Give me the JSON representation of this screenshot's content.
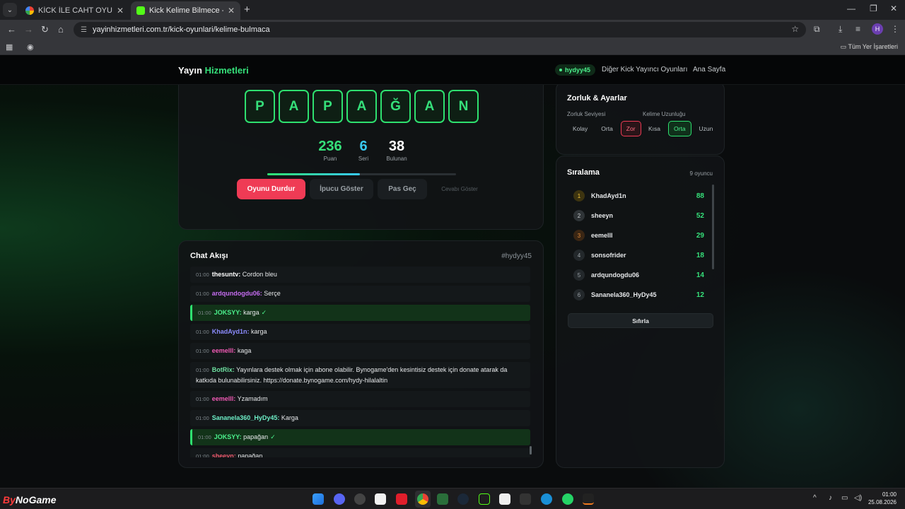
{
  "browser": {
    "tabs": [
      {
        "title": "KİCK İLE CAHT OYUNU - Google",
        "favicon": "google-icon"
      },
      {
        "title": "Kick Kelime Bilmece - Tahmin O",
        "favicon": "kick-icon"
      }
    ],
    "url": "yayinhizmetleri.com.tr/kick-oyunlari/kelime-bulmaca",
    "profile_initial": "H",
    "bookmarks_all": "Tüm Yer İşaretleri"
  },
  "header": {
    "brand_main": "Yayın",
    "brand_accent": "Hizmetleri",
    "user": "hydyy45",
    "links": [
      "Diğer Kick Yayıncı Oyunları",
      "Ana Sayfa"
    ]
  },
  "game": {
    "letters": [
      "P",
      "A",
      "P",
      "A",
      "Ğ",
      "A",
      "N"
    ],
    "stats": [
      {
        "value": "236",
        "label": "Puan",
        "color": "#35e07a"
      },
      {
        "value": "6",
        "label": "Seri",
        "color": "#38c9f0"
      },
      {
        "value": "38",
        "label": "Bulunan",
        "color": "#ffffff"
      }
    ],
    "progress": 0.49,
    "buttons": {
      "stop": "Oyunu Durdur",
      "hint": "İpucu Göster",
      "pass": "Pas Geç",
      "answer": "Cevabı Göster"
    }
  },
  "chat": {
    "title": "Chat Akışı",
    "channel": "#hydyy45",
    "messages": [
      {
        "time": "01:00",
        "user": "thesuntv:",
        "text": "Cordon bleu",
        "color": "#ffffff",
        "correct": false
      },
      {
        "time": "01:00",
        "user": "ardqundogdu06:",
        "text": "Serçe",
        "color": "#c56cf0",
        "correct": false
      },
      {
        "time": "01:00",
        "user": "JOKSYY:",
        "text": "karga",
        "color": "#4bf08c",
        "correct": true
      },
      {
        "time": "01:00",
        "user": "KhadAyd1n:",
        "text": "karga",
        "color": "#8c8cff",
        "correct": false
      },
      {
        "time": "01:00",
        "user": "eemelll:",
        "text": "kaga",
        "color": "#f05ab4",
        "correct": false
      },
      {
        "time": "01:00",
        "user": "BotRix:",
        "text": "Yayınlara destek olmak için abone olabilir. Bynogame'den kesintisiz destek için donate atarak da katkıda bulunabilirsiniz. https://donate.bynogame.com/hydy-hilalaltin",
        "color": "#6ee0a0",
        "correct": false
      },
      {
        "time": "01:00",
        "user": "eemelll:",
        "text": "Yzamadım",
        "color": "#f05ab4",
        "correct": false
      },
      {
        "time": "01:00",
        "user": "Sananela360_HyDy45:",
        "text": "Karga",
        "color": "#6ef0c8",
        "correct": false
      },
      {
        "time": "01:00",
        "user": "JOKSYY:",
        "text": "papağan",
        "color": "#4bf08c",
        "correct": true
      },
      {
        "time": "01:00",
        "user": "sheeyn:",
        "text": "papağan",
        "color": "#f05a6e",
        "correct": false
      }
    ],
    "check": "✓"
  },
  "settings": {
    "title": "Zorluk & Ayarlar",
    "difficulty_label": "Zorluk Seviyesi",
    "difficulty_options": [
      "Kolay",
      "Orta",
      "Zor"
    ],
    "difficulty_selected": "Zor",
    "length_label": "Kelime Uzunluğu",
    "length_options": [
      "Kısa",
      "Orta",
      "Uzun"
    ],
    "length_selected": "Orta"
  },
  "leaderboard": {
    "title": "Sıralama",
    "count": "9 oyuncu",
    "rows": [
      {
        "rank": "1",
        "name": "KhadAyd1n",
        "score": "88"
      },
      {
        "rank": "2",
        "name": "sheeyn",
        "score": "52"
      },
      {
        "rank": "3",
        "name": "eemelll",
        "score": "29"
      },
      {
        "rank": "4",
        "name": "sonsofrider",
        "score": "18"
      },
      {
        "rank": "5",
        "name": "ardqundogdu06",
        "score": "14"
      },
      {
        "rank": "6",
        "name": "Sananela360_HyDy45",
        "score": "12"
      }
    ],
    "reset": "Sıfırla"
  },
  "taskbar": {
    "logo_a": "By",
    "logo_b": "NoGame",
    "time": "01:00",
    "date": "25.08.2026"
  }
}
